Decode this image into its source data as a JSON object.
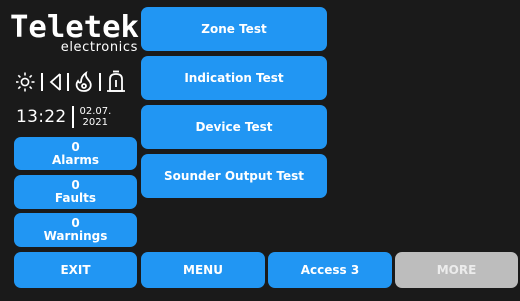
{
  "logo": {
    "brand": "Teletek",
    "sub": "electronics"
  },
  "status_icons": [
    "sun-icon",
    "speaker-icon",
    "flame-icon",
    "sounder-icon"
  ],
  "clock": {
    "time": "13:22",
    "date_line1": "02.07.",
    "date_line2": "2021"
  },
  "counters": [
    {
      "count": "0",
      "label": "Alarms"
    },
    {
      "count": "0",
      "label": "Faults"
    },
    {
      "count": "0",
      "label": "Warnings"
    }
  ],
  "tests": [
    {
      "label": "Zone Test"
    },
    {
      "label": "Indication Test"
    },
    {
      "label": "Device Test"
    },
    {
      "label": "Sounder Output Test"
    }
  ],
  "bottom_bar": {
    "exit": "EXIT",
    "menu": "MENU",
    "access": "Access 3",
    "more": "MORE"
  },
  "colors": {
    "background": "#1a1a1a",
    "button": "#2196f3",
    "button_disabled": "#bdbdbd"
  }
}
